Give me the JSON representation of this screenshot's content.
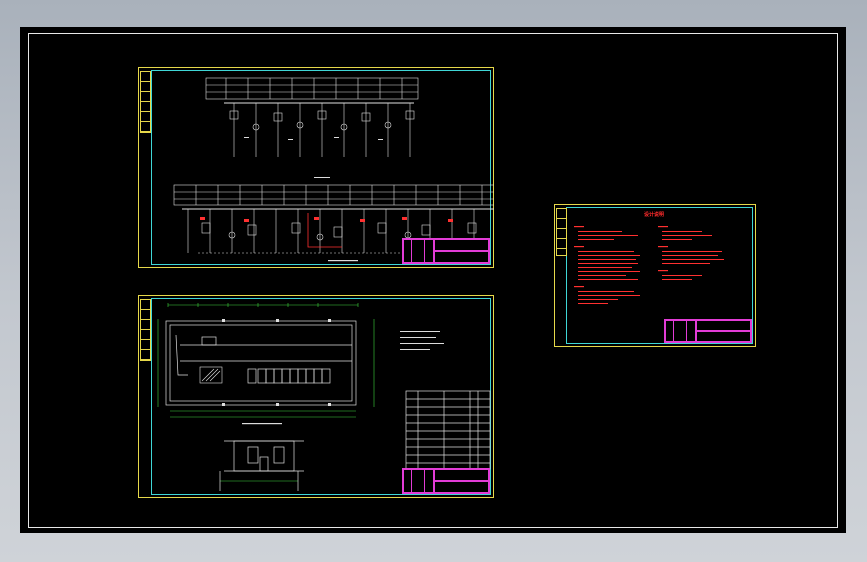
{
  "colors": {
    "background": "#000000",
    "frame_yellow": "#e6d84a",
    "frame_cyan": "#3fd6d6",
    "title_block_magenta": "#e23cd6",
    "notes_red": "#ff2b2b",
    "linework_white": "#e0e0e0",
    "dimension_green": "#3fd43f"
  },
  "sheets": [
    {
      "name": "single-line-diagram-sheet"
    },
    {
      "name": "floor-plan-sheet"
    },
    {
      "name": "design-notes-sheet"
    }
  ],
  "design_notes": {
    "title": "设计说明"
  }
}
